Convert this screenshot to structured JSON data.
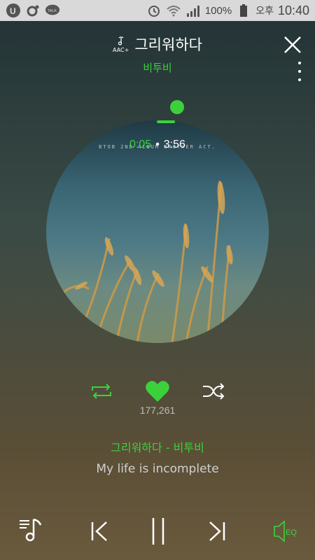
{
  "statusbar": {
    "battery": "100%",
    "ampm": "오후",
    "time": "10:40",
    "talk_label": "TALK"
  },
  "header": {
    "quality_label": "AAC+",
    "title": "그리워하다",
    "artist": "비투비"
  },
  "player": {
    "current_time": "0:05",
    "separator": "•",
    "total_time": "3:56",
    "progress": 0.021,
    "album_text": "BTOB 2ND ALBUM  BROTHER ACT.",
    "like_count": "177,261",
    "song_line": "그리워하다 - 비투비",
    "lyric": "My life is incomplete",
    "eq_label": "EQ"
  },
  "colors": {
    "accent": "#3cd13c",
    "statusbar_bg": "#d9d9d9"
  }
}
